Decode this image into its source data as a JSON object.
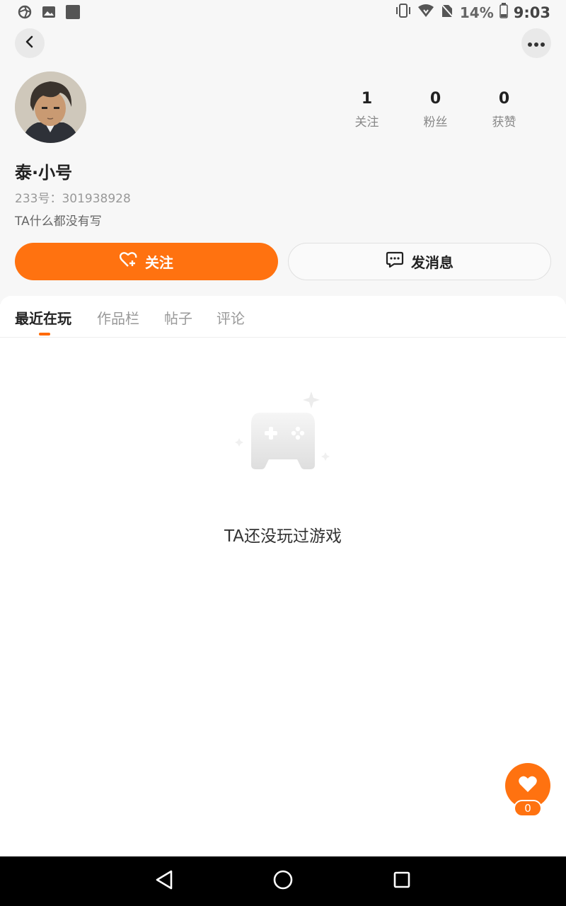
{
  "status_bar": {
    "battery_percent": "14%",
    "time": "9:03"
  },
  "profile": {
    "nickname": "泰·小号",
    "uid": "233号：301938928",
    "bio": "TA什么都没有写",
    "stats": [
      {
        "value": "1",
        "label": "关注"
      },
      {
        "value": "0",
        "label": "粉丝"
      },
      {
        "value": "0",
        "label": "获赞"
      }
    ]
  },
  "actions": {
    "follow_label": "关注",
    "message_label": "发消息"
  },
  "tabs": [
    {
      "label": "最近在玩",
      "active": true
    },
    {
      "label": "作品栏",
      "active": false
    },
    {
      "label": "帖子",
      "active": false
    },
    {
      "label": "评论",
      "active": false
    }
  ],
  "empty_state": {
    "text": "TA还没玩过游戏"
  },
  "floating_like": {
    "count": "0"
  },
  "colors": {
    "accent": "#ff7210",
    "background": "#f7f7f7"
  }
}
